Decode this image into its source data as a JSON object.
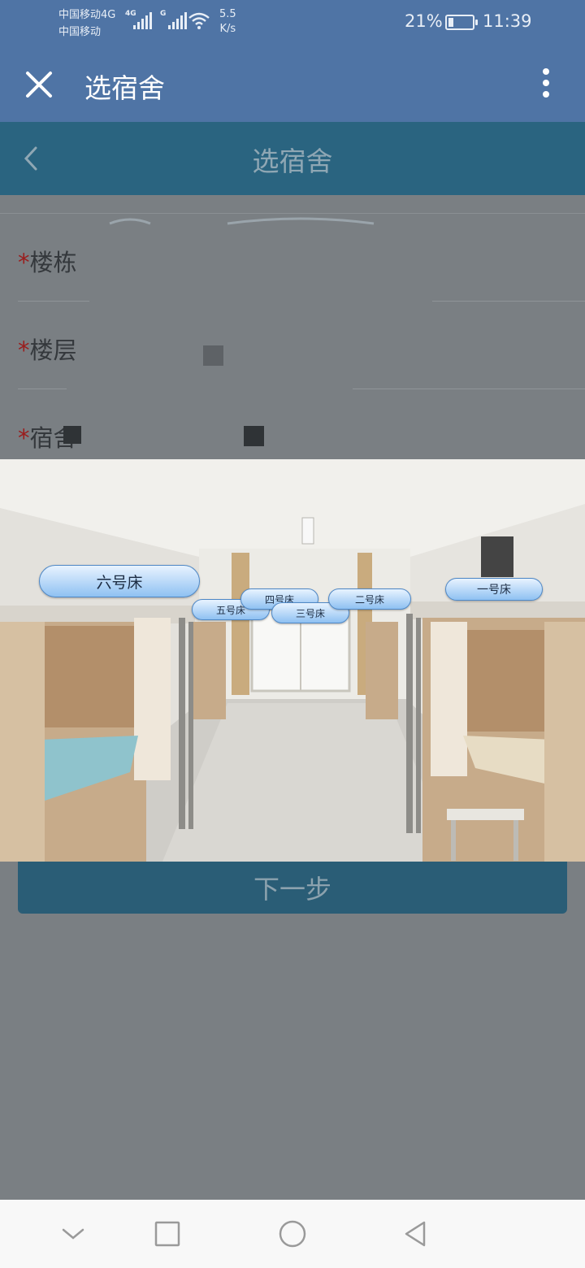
{
  "status_bar": {
    "carrier_1": "中国移动4G",
    "carrier_2": "中国移动",
    "sig1_badge": "4G",
    "sig2_badge": "G",
    "speed_value": "5.5",
    "speed_unit": "K/s",
    "battery_percent": "21%",
    "battery_level": 0.21,
    "time": "11:39"
  },
  "title_bar": {
    "title": "选宿舍",
    "close_icon": "close-icon",
    "more_icon": "more-vertical-icon"
  },
  "page_header": {
    "title": "选宿舍",
    "back_icon": "chevron-left-icon"
  },
  "form": {
    "fields": [
      {
        "required_mark": "*",
        "label": "楼栋"
      },
      {
        "required_mark": "*",
        "label": "楼层"
      },
      {
        "required_mark": "*",
        "label": "宿舍"
      }
    ]
  },
  "dorm_photo": {
    "beds": [
      {
        "label": "六号床"
      },
      {
        "label": "五号床"
      },
      {
        "label": "四号床"
      },
      {
        "label": "三号床"
      },
      {
        "label": "二号床"
      },
      {
        "label": "一号床"
      }
    ]
  },
  "next_button": {
    "label": "下一步"
  },
  "nav_bar": {
    "icons": [
      "chevron-down-icon",
      "square-icon",
      "circle-icon",
      "triangle-back-icon"
    ]
  },
  "colors": {
    "title_bar": "#4f74a5",
    "page_header": "#2a6480",
    "overlay_gray": "#7a7f83",
    "required": "#9a1d1d"
  }
}
